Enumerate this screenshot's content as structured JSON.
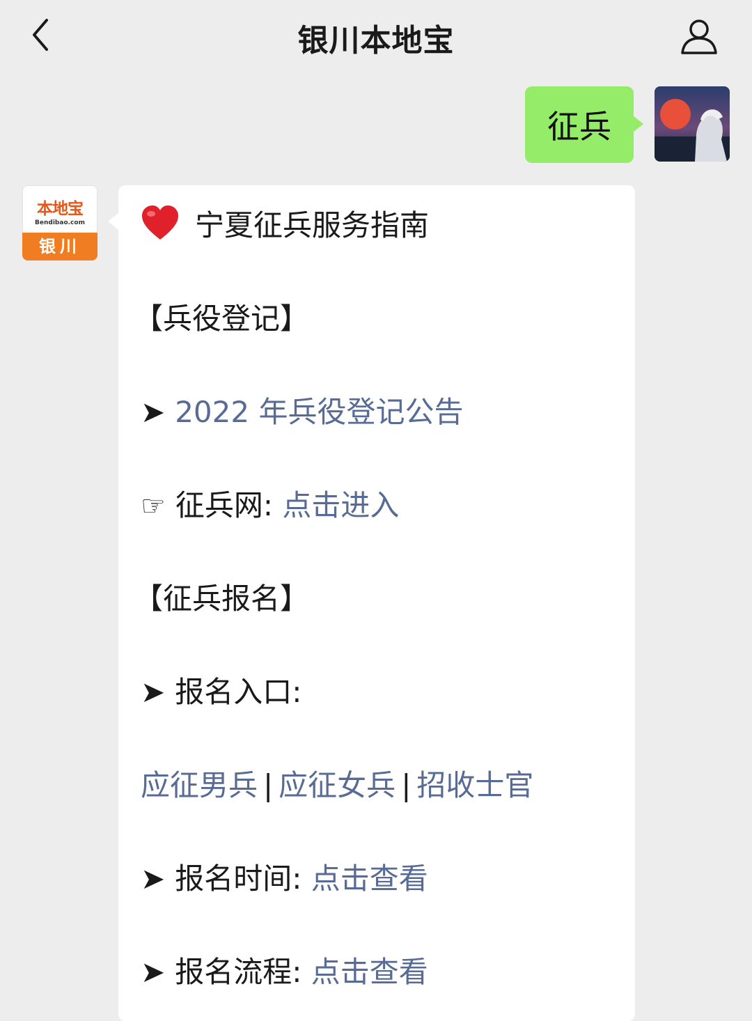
{
  "header": {
    "title": "银川本地宝",
    "back_icon": "back-icon",
    "profile_icon": "person-icon"
  },
  "outgoing": {
    "text": "征兵",
    "bubble_color": "#95ec69"
  },
  "incoming": {
    "avatar": {
      "logo_text": "本地宝",
      "logo_domain": "Bendibao.com",
      "logo_city": "银川"
    },
    "heading": {
      "icon": "heart-icon",
      "text": "宁夏征兵服务指南"
    },
    "section1": "【兵役登记】",
    "item_registration": {
      "arrow": "➤",
      "link": "2022 年兵役登记公告"
    },
    "item_website": {
      "icon": "☞",
      "label": "征兵网:",
      "link": "点击进入"
    },
    "section2": "【征兵报名】",
    "item_entry": {
      "arrow": "➤",
      "label": "报名入口:"
    },
    "entry_links": {
      "male": "应征男兵",
      "sep1": "|",
      "female": "应征女兵",
      "sep2": "|",
      "officer": "招收士官"
    },
    "item_time": {
      "arrow": "➤",
      "label": "报名时间:",
      "link": "点击查看"
    },
    "item_process": {
      "arrow": "➤",
      "label": "报名流程:",
      "link": "点击查看"
    },
    "link_color": "#576b95"
  }
}
